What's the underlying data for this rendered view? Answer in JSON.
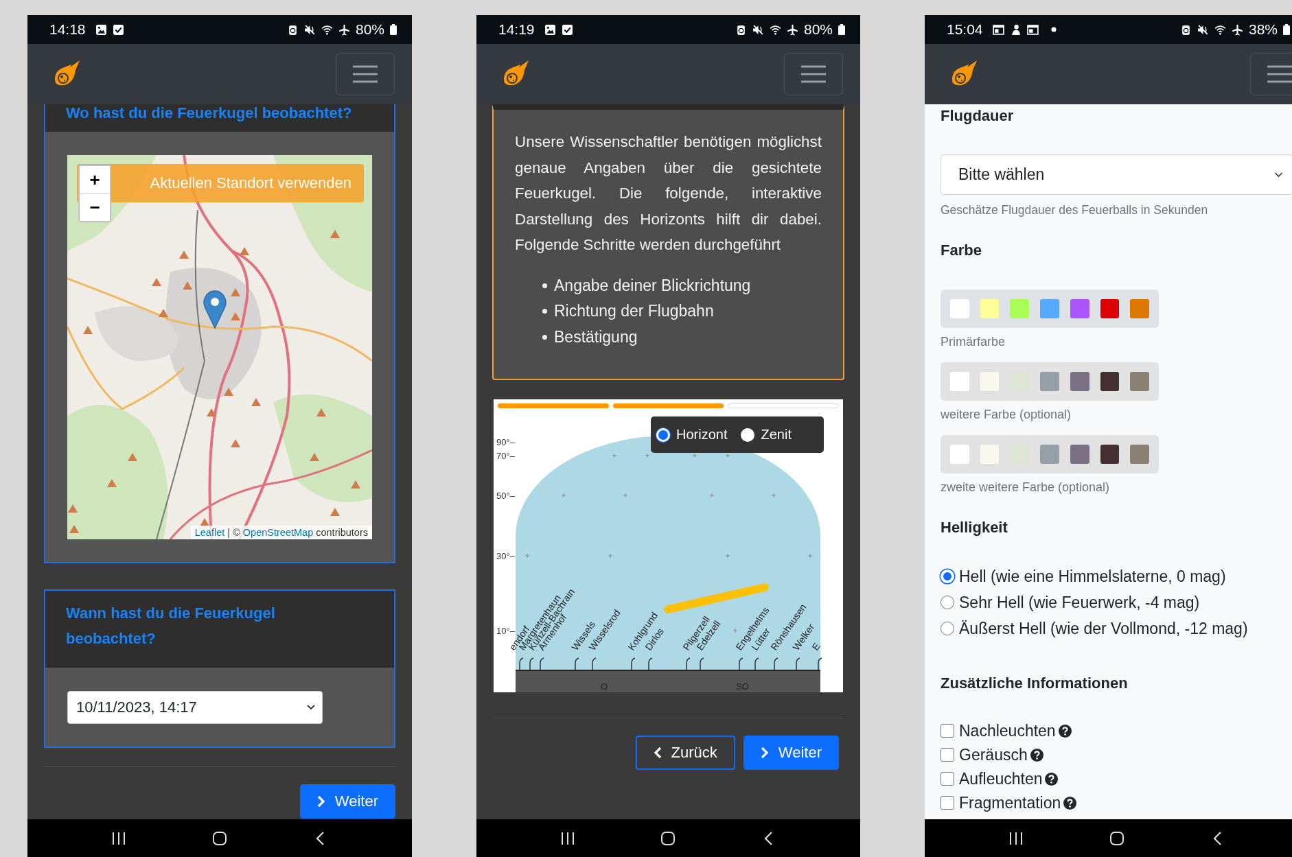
{
  "phones": [
    {
      "kind": "location",
      "status_bar": {
        "time": "14:18",
        "battery": "80%"
      },
      "location_card": {
        "title": "Wo hast du die Feuerkugel beobachtet?",
        "locate_button": "Aktuellen Standort verwenden",
        "zoom_in": "+",
        "zoom_out": "−",
        "attribution": {
          "leaflet": "Leaflet",
          "middle": "| ©",
          "osm": "OpenStreetMap",
          "end": "contributors"
        }
      },
      "time_card": {
        "title": "Wann hast du die Feuerkugel beobachtet?",
        "value": "10/11/2023, 14:17"
      },
      "buttons": [
        {
          "label": "Weiter",
          "kind": "next"
        }
      ]
    },
    {
      "kind": "horizon",
      "status_bar": {
        "time": "14:19",
        "battery": "80%"
      },
      "intro": {
        "text": "Unsere Wissenschaftler benötigen möglichst genaue Angaben über die gesichtete Feuerkugel. Die folgende, interaktive Darstellung des Horizonts hilft dir dabei. Folgende Schritte werden durchgeführt",
        "steps": [
          "Angabe deiner Blickrichtung",
          "Richtung der Flugbahn",
          "Bestätigung"
        ]
      },
      "progress": [
        {
          "done": true
        },
        {
          "done": true
        },
        {
          "done": false
        }
      ],
      "view_modes": [
        {
          "label": "Horizont",
          "selected": true
        },
        {
          "label": "Zenit",
          "selected": false
        }
      ],
      "altitude_labels": [
        "90°–",
        "70°–",
        "50°–",
        "30°–",
        "10°–"
      ],
      "places": [
        "endorf",
        "Margretenhaun",
        "Künzell-Bachrain",
        "Armenhof",
        "Wissels",
        "Wisselsrod",
        "Kohlgrund",
        "Dirlos",
        "Pilgerzell",
        "Edelzell",
        "Engelhelms",
        "Lütter",
        "Rönshausen",
        "Welker",
        "E"
      ],
      "directions": [
        "O",
        "SO"
      ],
      "buttons": [
        {
          "label": "Zurück",
          "kind": "back"
        },
        {
          "label": "Weiter",
          "kind": "next"
        }
      ]
    },
    {
      "kind": "details",
      "status_bar": {
        "time": "15:04",
        "battery": "38%"
      },
      "duration": {
        "heading": "Flugdauer",
        "value": "Bitte wählen",
        "hint": "Geschätze Flugdauer des Feuerballs in Sekunden"
      },
      "color": {
        "heading": "Farbe",
        "palettes": [
          {
            "label": "Primärfarbe",
            "swatches": [
              {
                "color": "#ffffff"
              },
              {
                "color": "#ffff99"
              },
              {
                "color": "#a8ff55"
              },
              {
                "color": "#55aaff"
              },
              {
                "color": "#aa55ff"
              },
              {
                "color": "#dd0000"
              },
              {
                "color": "#dd7700"
              }
            ]
          },
          {
            "label": "weitere Farbe (optional)",
            "swatches": [
              {
                "color": "#ffffff"
              },
              {
                "color": "#f8f8ee"
              },
              {
                "color": "#dde5d5"
              },
              {
                "color": "#96a0a8"
              },
              {
                "color": "#7a7084"
              },
              {
                "color": "#443030"
              },
              {
                "color": "#8a8074"
              }
            ]
          },
          {
            "label": "zweite weitere Farbe (optional)",
            "swatches": [
              {
                "color": "#ffffff"
              },
              {
                "color": "#f8f8ee"
              },
              {
                "color": "#dde5d5"
              },
              {
                "color": "#96a0a8"
              },
              {
                "color": "#7a7084"
              },
              {
                "color": "#443030"
              },
              {
                "color": "#8a8074"
              }
            ]
          }
        ]
      },
      "brightness": {
        "heading": "Helligkeit",
        "options": [
          {
            "label": "Hell (wie eine Himmelslaterne, 0 mag)",
            "selected": true
          },
          {
            "label": "Sehr Hell (wie Feuerwerk, -4 mag)",
            "selected": false
          },
          {
            "label": "Äußerst Hell (wie der Vollmond, -12 mag)",
            "selected": false
          }
        ]
      },
      "extra": {
        "heading": "Zusätzliche Informationen",
        "options": [
          {
            "label": "Nachleuchten",
            "checked": false
          },
          {
            "label": "Geräusch",
            "checked": false
          },
          {
            "label": "Aufleuchten",
            "checked": false
          },
          {
            "label": "Fragmentation",
            "checked": false
          }
        ]
      }
    }
  ]
}
